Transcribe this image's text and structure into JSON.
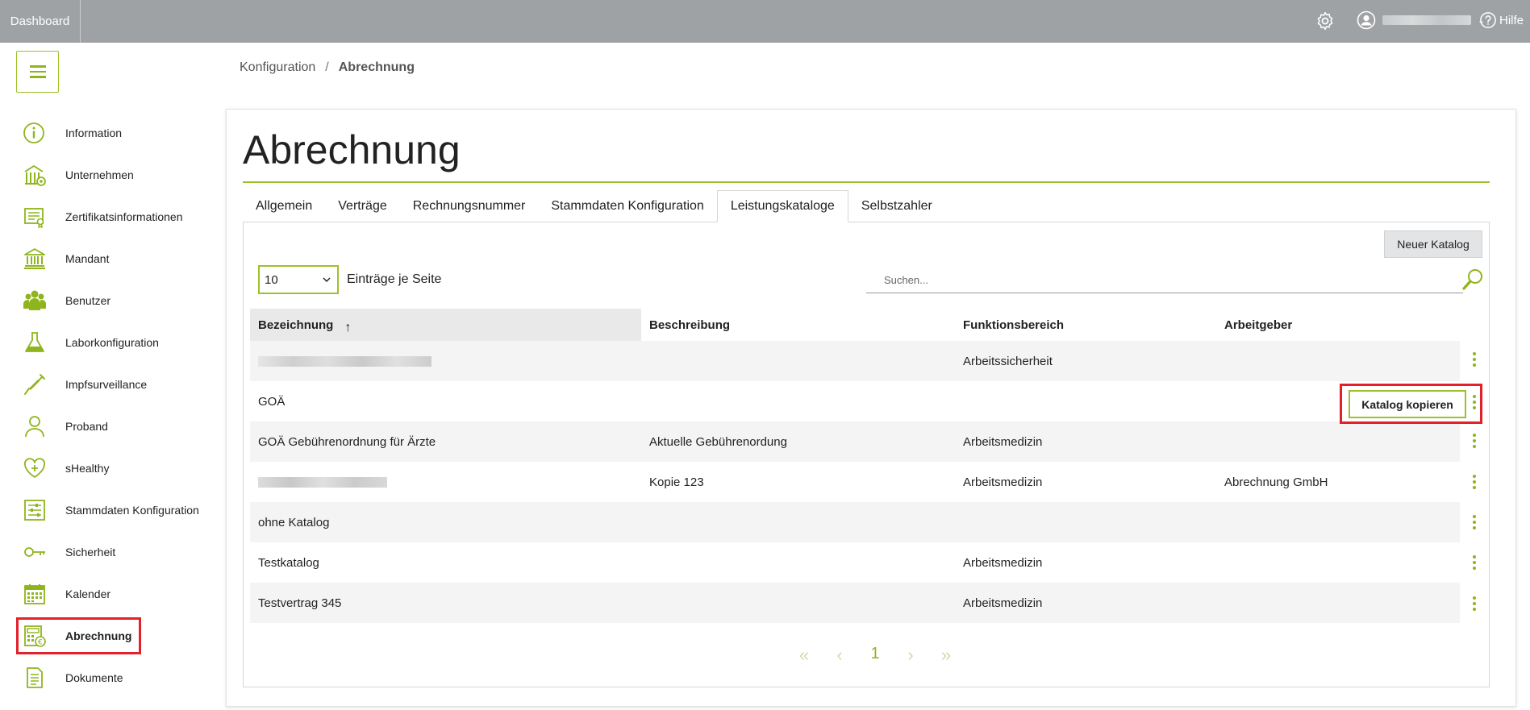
{
  "topbar": {
    "dashboard_label": "Dashboard",
    "help_label": "Hilfe",
    "icons": [
      "gear-icon",
      "user-icon",
      "chevron-down-icon",
      "help-icon"
    ]
  },
  "breadcrumb": {
    "parent": "Konfiguration",
    "separator": "/",
    "current": "Abrechnung"
  },
  "sidebar": {
    "items": [
      {
        "label": "Information",
        "icon": "info-icon"
      },
      {
        "label": "Unternehmen",
        "icon": "company-icon"
      },
      {
        "label": "Zertifikatsinformationen",
        "icon": "certificate-icon"
      },
      {
        "label": "Mandant",
        "icon": "bank-icon"
      },
      {
        "label": "Benutzer",
        "icon": "users-icon"
      },
      {
        "label": "Laborkonfiguration",
        "icon": "flask-icon"
      },
      {
        "label": "Impfsurveillance",
        "icon": "syringe-icon"
      },
      {
        "label": "Proband",
        "icon": "person-icon"
      },
      {
        "label": "sHealthy",
        "icon": "heart-plus-icon"
      },
      {
        "label": "Stammdaten Konfiguration",
        "icon": "sliders-icon"
      },
      {
        "label": "Sicherheit",
        "icon": "key-icon"
      },
      {
        "label": "Kalender",
        "icon": "calendar-icon"
      },
      {
        "label": "Abrechnung",
        "icon": "calculator-icon"
      },
      {
        "label": "Dokumente",
        "icon": "document-icon"
      }
    ]
  },
  "page": {
    "title": "Abrechnung",
    "tabs": [
      {
        "label": "Allgemein"
      },
      {
        "label": "Verträge"
      },
      {
        "label": "Rechnungsnummer"
      },
      {
        "label": "Stammdaten Konfiguration"
      },
      {
        "label": "Leistungskataloge"
      },
      {
        "label": "Selbstzahler"
      }
    ],
    "active_tab": "Leistungskataloge",
    "new_button": "Neuer Katalog",
    "page_size": "10",
    "page_size_label": "Einträge je Seite",
    "search_placeholder": "Suchen...",
    "sort_arrow": "↑"
  },
  "table": {
    "headers": [
      "Bezeichnung",
      "Beschreibung",
      "Funktionsbereich",
      "Arbeitgeber"
    ],
    "rows": [
      {
        "bezeichnung": "",
        "beschreibung": "",
        "funktionsbereich": "Arbeitssicherheit",
        "arbeitgeber": ""
      },
      {
        "bezeichnung": "GOÄ",
        "beschreibung": "",
        "funktionsbereich": "",
        "arbeitgeber": ""
      },
      {
        "bezeichnung": "GOÄ Gebührenordnung für Ärzte",
        "beschreibung": "Aktuelle Gebührenordung",
        "funktionsbereich": "Arbeitsmedizin",
        "arbeitgeber": ""
      },
      {
        "bezeichnung": "",
        "beschreibung": "Kopie 123",
        "funktionsbereich": "Arbeitsmedizin",
        "arbeitgeber": "Abrechnung GmbH"
      },
      {
        "bezeichnung": "ohne Katalog",
        "beschreibung": "",
        "funktionsbereich": "",
        "arbeitgeber": ""
      },
      {
        "bezeichnung": "Testkatalog",
        "beschreibung": "",
        "funktionsbereich": "Arbeitsmedizin",
        "arbeitgeber": ""
      },
      {
        "bezeichnung": "Testvertrag 345",
        "beschreibung": "",
        "funktionsbereich": "Arbeitsmedizin",
        "arbeitgeber": ""
      }
    ]
  },
  "row_menu": {
    "copy_button": "Katalog kopieren"
  },
  "pager": {
    "first": "«",
    "prev": "‹",
    "current": "1",
    "next": "›",
    "last": "»"
  },
  "colors": {
    "accent": "#8fb51d",
    "topbar": "#9fa2a5",
    "highlight": "#e4202a"
  }
}
